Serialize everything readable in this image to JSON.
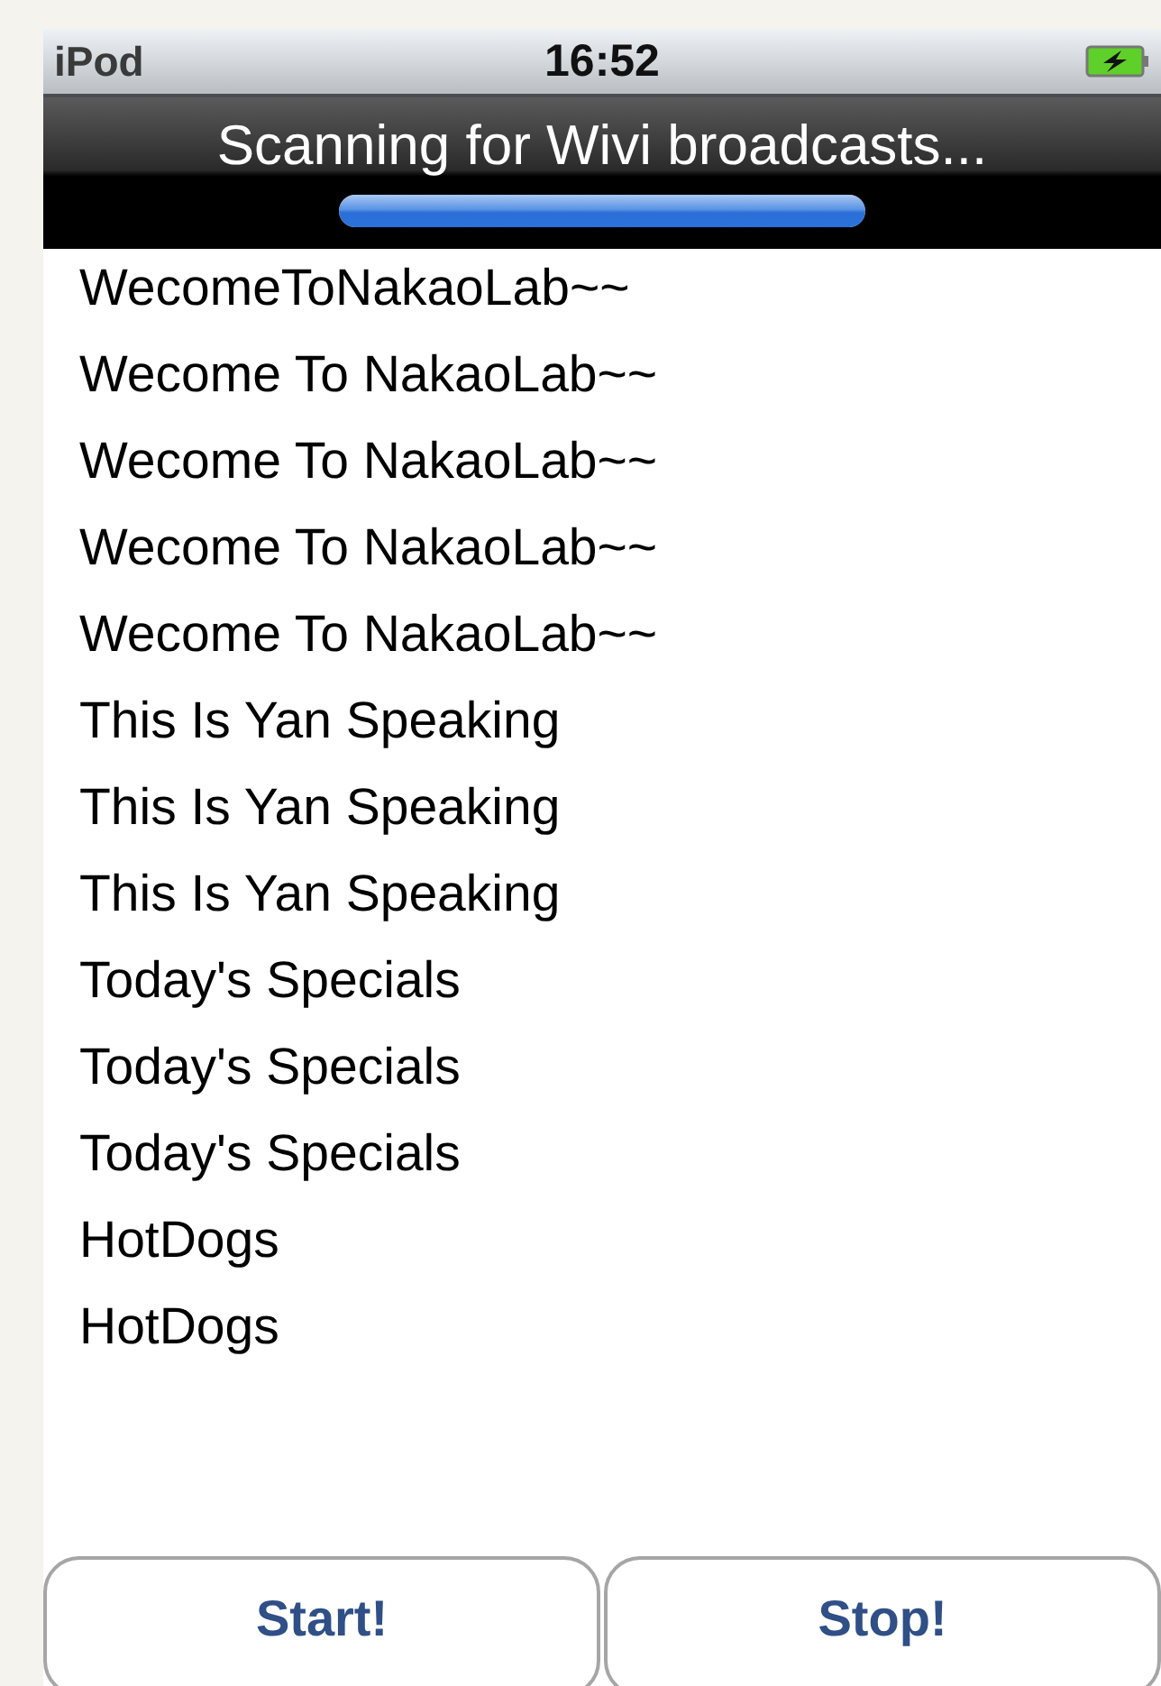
{
  "status_bar": {
    "carrier": "iPod",
    "time": "16:52"
  },
  "nav_bar": {
    "title": "Scanning for Wivi broadcasts...",
    "progress": {
      "level": 1
    }
  },
  "list": [
    {
      "text": "WecomeToNakaoLab~~"
    },
    {
      "text": "Wecome To NakaoLab~~"
    },
    {
      "text": "Wecome To NakaoLab~~"
    },
    {
      "text": "Wecome To NakaoLab~~"
    },
    {
      "text": "Wecome To NakaoLab~~"
    },
    {
      "text": "This Is Yan Speaking"
    },
    {
      "text": "This Is Yan Speaking"
    },
    {
      "text": "This Is Yan Speaking"
    },
    {
      "text": "Today's Specials"
    },
    {
      "text": "Today's Specials"
    },
    {
      "text": "Today's Specials"
    },
    {
      "text": "HotDogs"
    },
    {
      "text": "HotDogs"
    }
  ],
  "buttons": [
    "Start!",
    "Stop!"
  ]
}
